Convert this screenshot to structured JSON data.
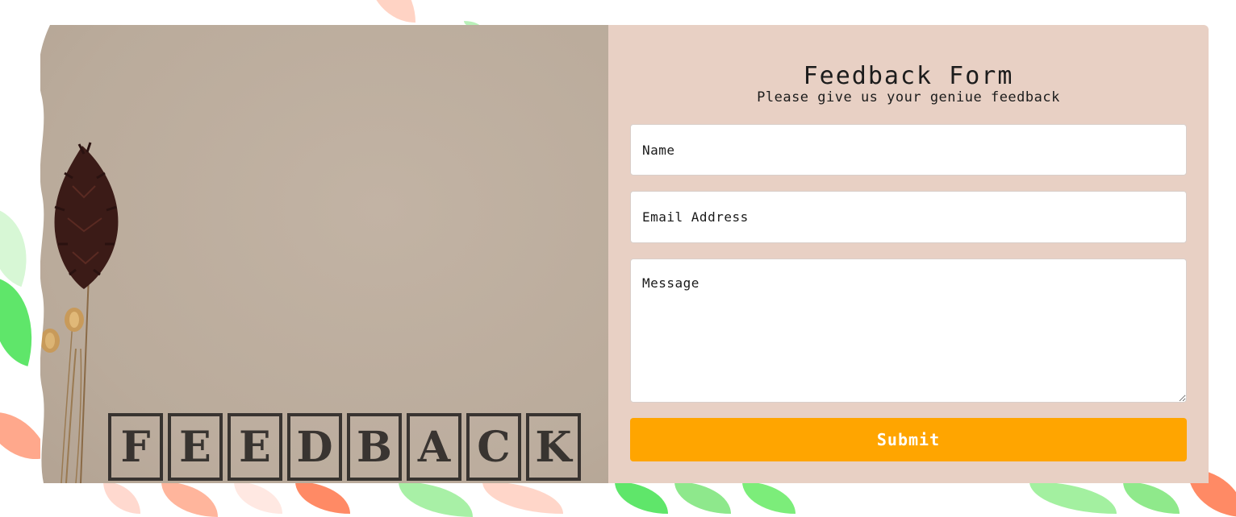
{
  "form": {
    "title": "Feedback Form",
    "subtitle": "Please give us your geniue feedback",
    "name_placeholder": "Name",
    "email_placeholder": "Email Address",
    "message_placeholder": "Message",
    "submit_label": "Submit"
  },
  "photo": {
    "stamp_letters": [
      "F",
      "E",
      "E",
      "D",
      "B",
      "A",
      "C",
      "K"
    ]
  },
  "colors": {
    "form_background": "#e8d0c4",
    "submit_button": "#ffa500",
    "photo_background": "#bcad9d",
    "leaf_green": "#5fe66a",
    "leaf_salmon": "#ff8a65"
  }
}
